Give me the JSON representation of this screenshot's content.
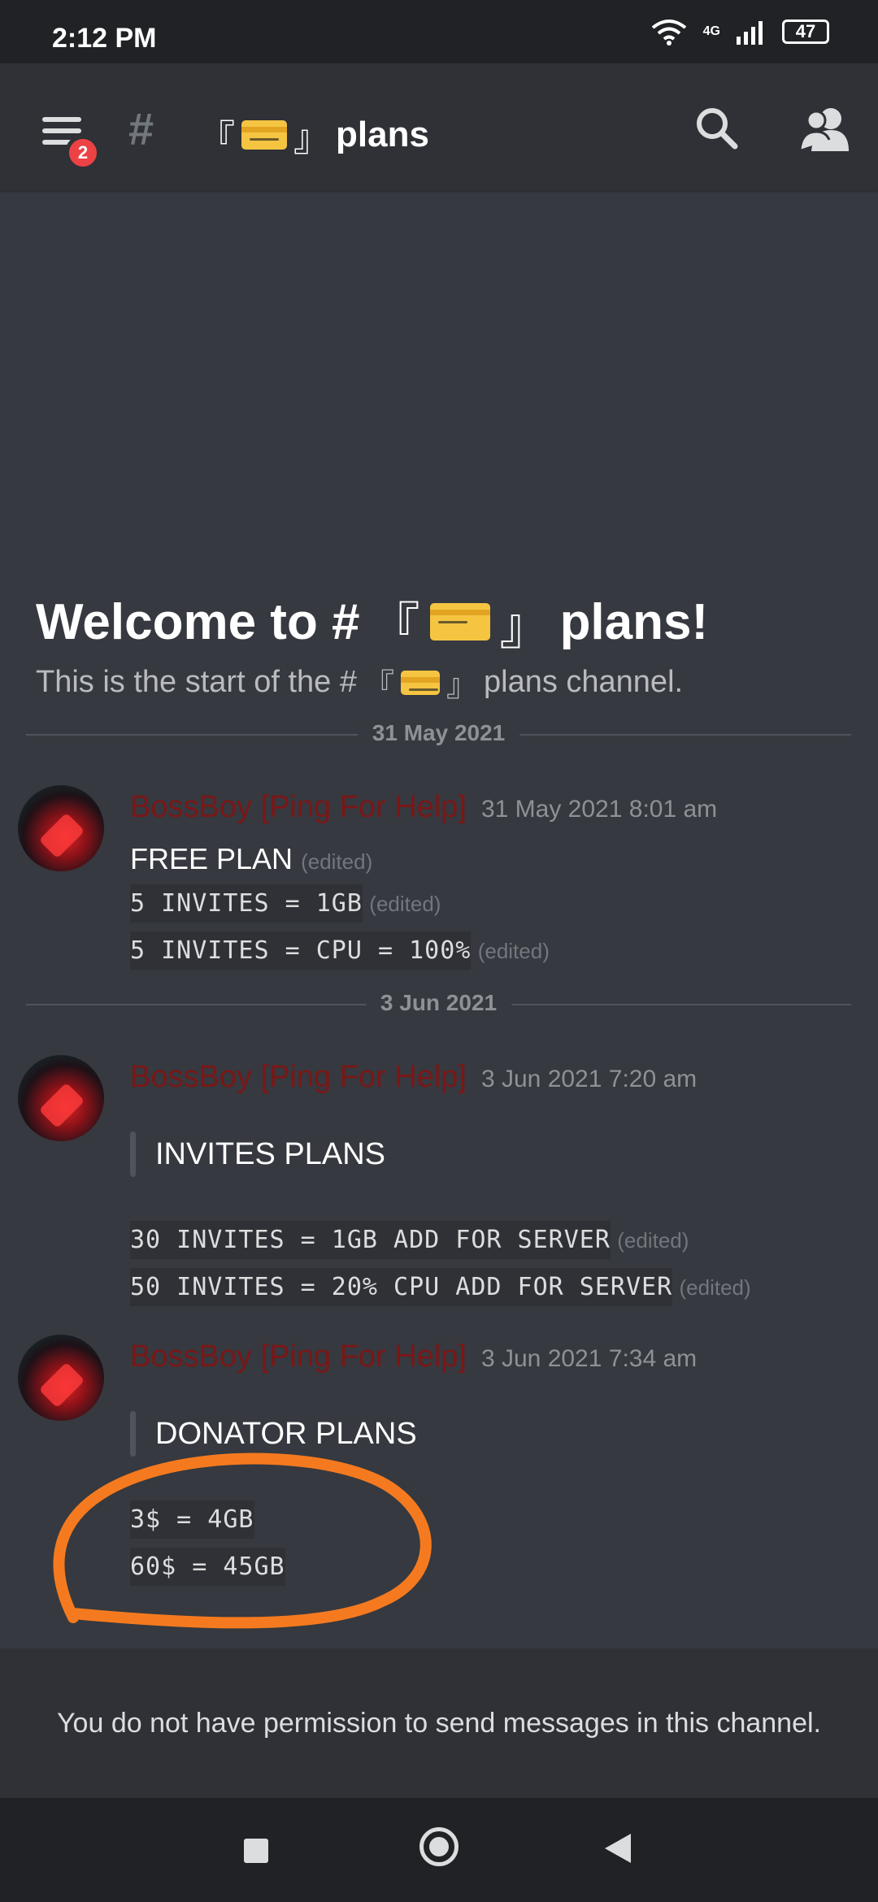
{
  "status_bar": {
    "time": "2:12 PM",
    "network": "4G",
    "battery": "47"
  },
  "header": {
    "badge_count": "2",
    "bracket_open": "『",
    "bracket_close": "』",
    "channel_name": "plans",
    "hash": "#",
    "icons": [
      "menu-icon",
      "hash-icon",
      "credit-card-icon",
      "search-icon",
      "members-icon"
    ]
  },
  "welcome": {
    "title_prefix": "Welcome to #",
    "title_suffix": "plans!",
    "subtitle_prefix": "This is the start of the #",
    "subtitle_suffix": "plans channel."
  },
  "dividers": [
    "31 May 2021",
    "3 Jun 2021"
  ],
  "messages": [
    {
      "author": "BossBoy [Ping For Help]",
      "timestamp": "31 May 2021 8:01 am",
      "title": "FREE PLAN",
      "title_edited": "(edited)",
      "lines": [
        {
          "code": "5 INVITES = 1GB",
          "edited": "(edited)"
        },
        {
          "code": "5 INVITES = CPU = 100%",
          "edited": "(edited)"
        }
      ]
    },
    {
      "author": "BossBoy [Ping For Help]",
      "timestamp": "3 Jun 2021 7:20 am",
      "quote": "INVITES PLANS",
      "lines": [
        {
          "code": "30 INVITES = 1GB ADD FOR SERVER",
          "edited": "(edited)"
        },
        {
          "code": "50 INVITES = 20% CPU ADD FOR SERVER",
          "edited": "(edited)"
        }
      ]
    },
    {
      "author": "BossBoy [Ping For Help]",
      "timestamp": "3 Jun 2021 7:34 am",
      "quote": "DONATOR PLANS",
      "lines": [
        {
          "code": "3$ = 4GB"
        },
        {
          "code": "60$ = 45GB"
        }
      ]
    }
  ],
  "composer": {
    "permission_text": "You do not have permission to send messages in this channel."
  },
  "colors": {
    "background": "#36393f",
    "header": "#2f3136",
    "author": "#7a1717",
    "annotation": "#f57a1f",
    "badge": "#ed4245"
  }
}
